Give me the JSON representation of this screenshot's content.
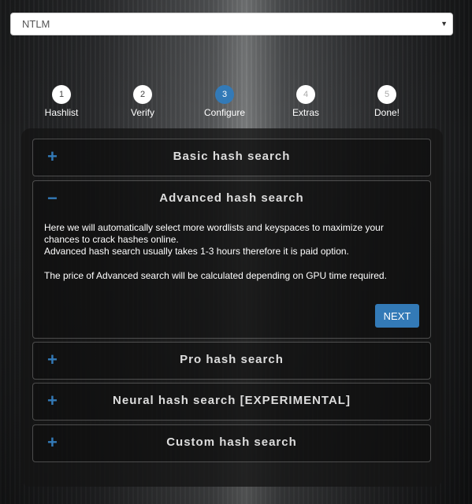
{
  "hash_type": {
    "selected": "NTLM"
  },
  "steps": [
    {
      "num": "1",
      "label": "Hashlist"
    },
    {
      "num": "2",
      "label": "Verify"
    },
    {
      "num": "3",
      "label": "Configure"
    },
    {
      "num": "4",
      "label": "Extras"
    },
    {
      "num": "5",
      "label": "Done!"
    }
  ],
  "accordion": {
    "basic": {
      "sign": "+",
      "title": "Basic hash search"
    },
    "advanced": {
      "sign": "−",
      "title": "Advanced hash search",
      "line1": "Here we will automatically select more wordlists and keyspaces to maximize your chances to crack hashes online.",
      "line2": "Advanced hash search usually takes 1-3 hours therefore it is paid option.",
      "line3": "The price of Advanced search will be calculated depending on GPU time required.",
      "next_label": "NEXT"
    },
    "pro": {
      "sign": "+",
      "title": "Pro hash search"
    },
    "neural": {
      "sign": "+",
      "title": "Neural hash search [EXPERIMENTAL]"
    },
    "custom": {
      "sign": "+",
      "title": "Custom hash search"
    }
  },
  "colors": {
    "accent": "#337ab7"
  }
}
